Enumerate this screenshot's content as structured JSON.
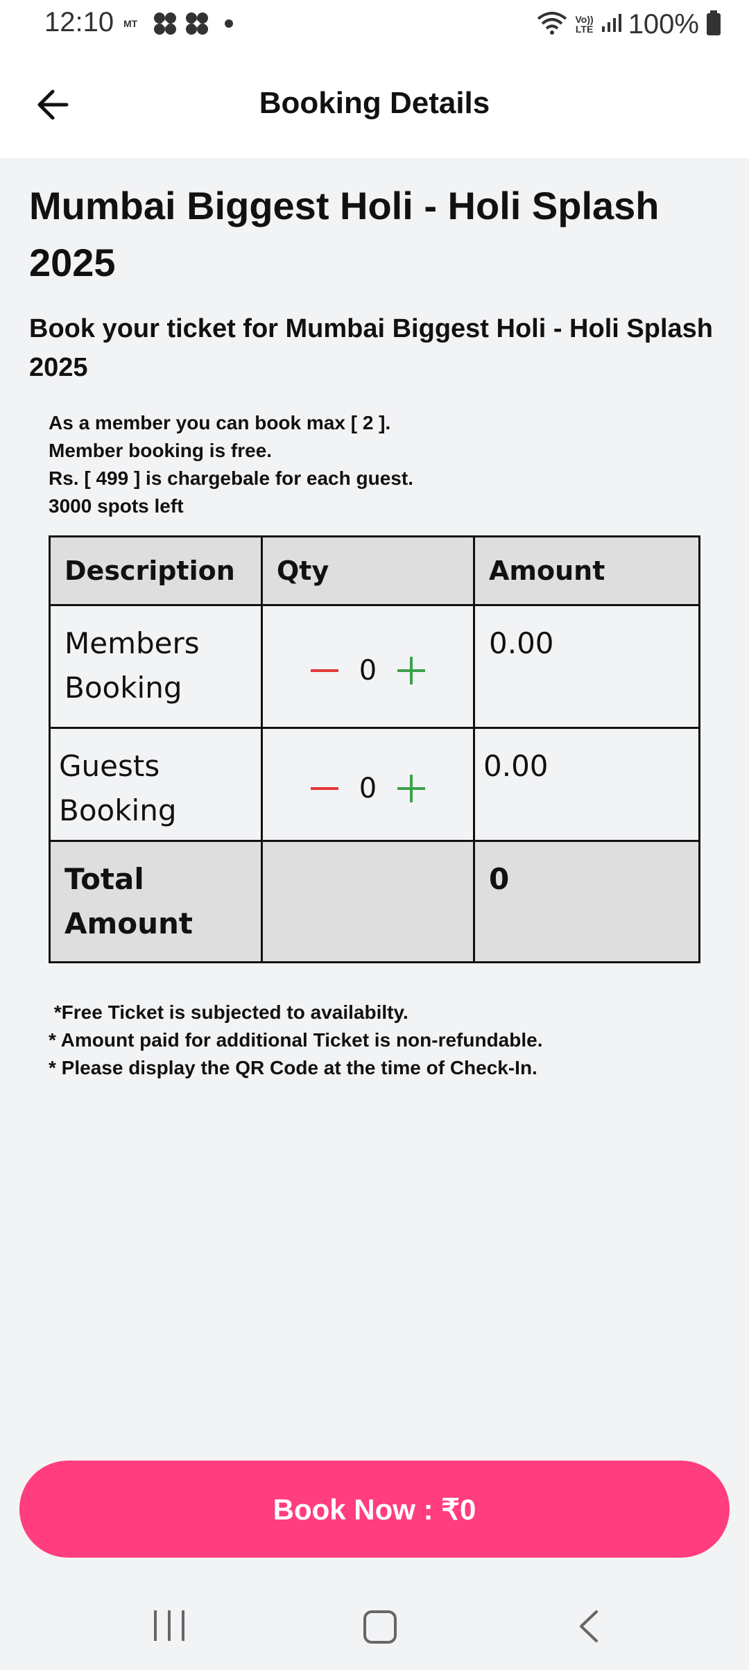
{
  "status_bar": {
    "time": "12:10",
    "carrier": "MT",
    "battery": "100%",
    "volte": "Vo))\nLTE"
  },
  "app_bar": {
    "title": "Booking Details"
  },
  "event": {
    "title": "Mumbai Biggest Holi - Holi Splash 2025",
    "subtitle": "Book your ticket for Mumbai Biggest Holi - Holi Splash 2025"
  },
  "info": {
    "line1": "As a member you can book max [ 2 ].",
    "line2": "Member booking is free.",
    "line3": "Rs. [ 499 ] is chargebale for each guest.",
    "line4": "3000 spots left"
  },
  "table": {
    "headers": [
      "Description",
      "Qty",
      "Amount"
    ],
    "rows": [
      {
        "description": "Members Booking",
        "qty": "0",
        "amount": "0.00"
      },
      {
        "description": "Guests Booking",
        "qty": "0",
        "amount": "0.00"
      }
    ],
    "total_label": "Total Amount",
    "total_value": "0"
  },
  "notes": {
    "line1": " *Free Ticket is subjected to availabilty.",
    "line2": "* Amount paid for additional Ticket is non-refundable.",
    "line3": "* Please display the QR Code at the time of Check-In."
  },
  "book_button": {
    "label": "Book Now : ₹0"
  },
  "colors": {
    "accent": "#ff3d7f",
    "minus": "#e53935",
    "plus": "#3aa14a"
  }
}
